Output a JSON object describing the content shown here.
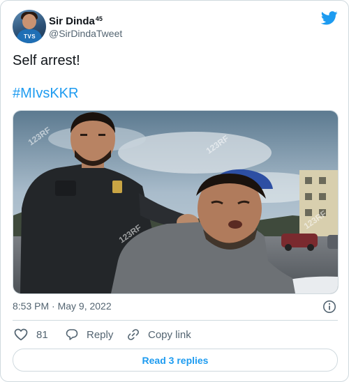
{
  "author": {
    "display_name": "Sir Dinda",
    "name_badge": "45",
    "handle": "@SirDindaTweet",
    "avatar_logo": "TVS"
  },
  "tweet": {
    "text": "Self arrest!",
    "hashtag": "#MIvsKKR",
    "timestamp": "8:53 PM · May 9, 2022"
  },
  "media": {
    "watermark": "123RF"
  },
  "actions": {
    "like_count": "81",
    "reply_label": "Reply",
    "copy_label": "Copy link",
    "read_replies_label": "Read 3 replies"
  },
  "icons": {
    "brand": "twitter-bird-icon",
    "info": "info-icon",
    "like": "heart-icon",
    "reply": "speech-bubble-icon",
    "copy": "link-icon"
  },
  "colors": {
    "accent": "#1d9bf0",
    "text": "#0f1419",
    "muted": "#536471",
    "border": "#cfd9de"
  }
}
